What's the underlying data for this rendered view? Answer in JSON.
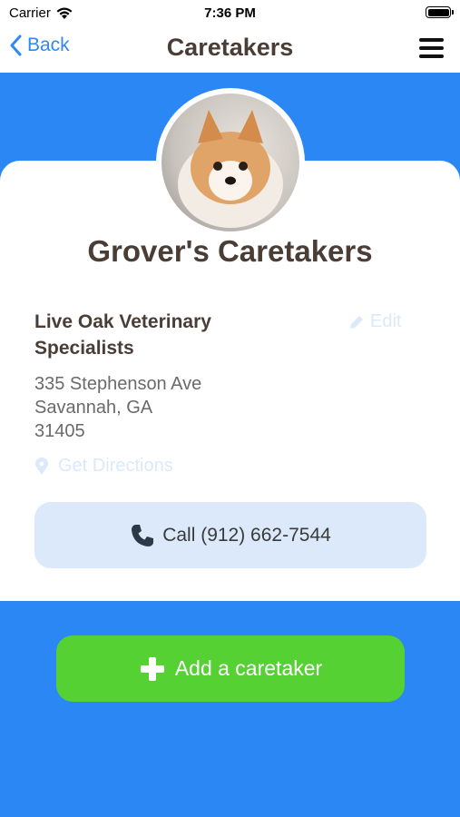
{
  "status_bar": {
    "carrier": "Carrier",
    "time": "7:36 PM",
    "wifi_icon": "wifi-icon",
    "battery_icon": "battery-icon"
  },
  "nav": {
    "back_label": "Back",
    "title": "Caretakers",
    "menu_icon": "hamburger-menu-icon"
  },
  "profile": {
    "avatar": "dog-photo",
    "title": "Grover's Caretakers"
  },
  "caretaker": {
    "name": "Live Oak Veterinary Specialists",
    "edit_label": "Edit",
    "address_line1": "335 Stephenson Ave",
    "address_line2": "Savannah, GA",
    "address_line3": "31405",
    "directions_label": "Get Directions",
    "call_label": "Call (912) 662-7544"
  },
  "actions": {
    "add_label": "Add a caretaker"
  },
  "colors": {
    "accent_blue": "#2a87f3",
    "link_blue": "#2f88f5",
    "title_brown": "#4a3d36",
    "light_blue": "#dbe9fb",
    "green": "#56d133"
  }
}
